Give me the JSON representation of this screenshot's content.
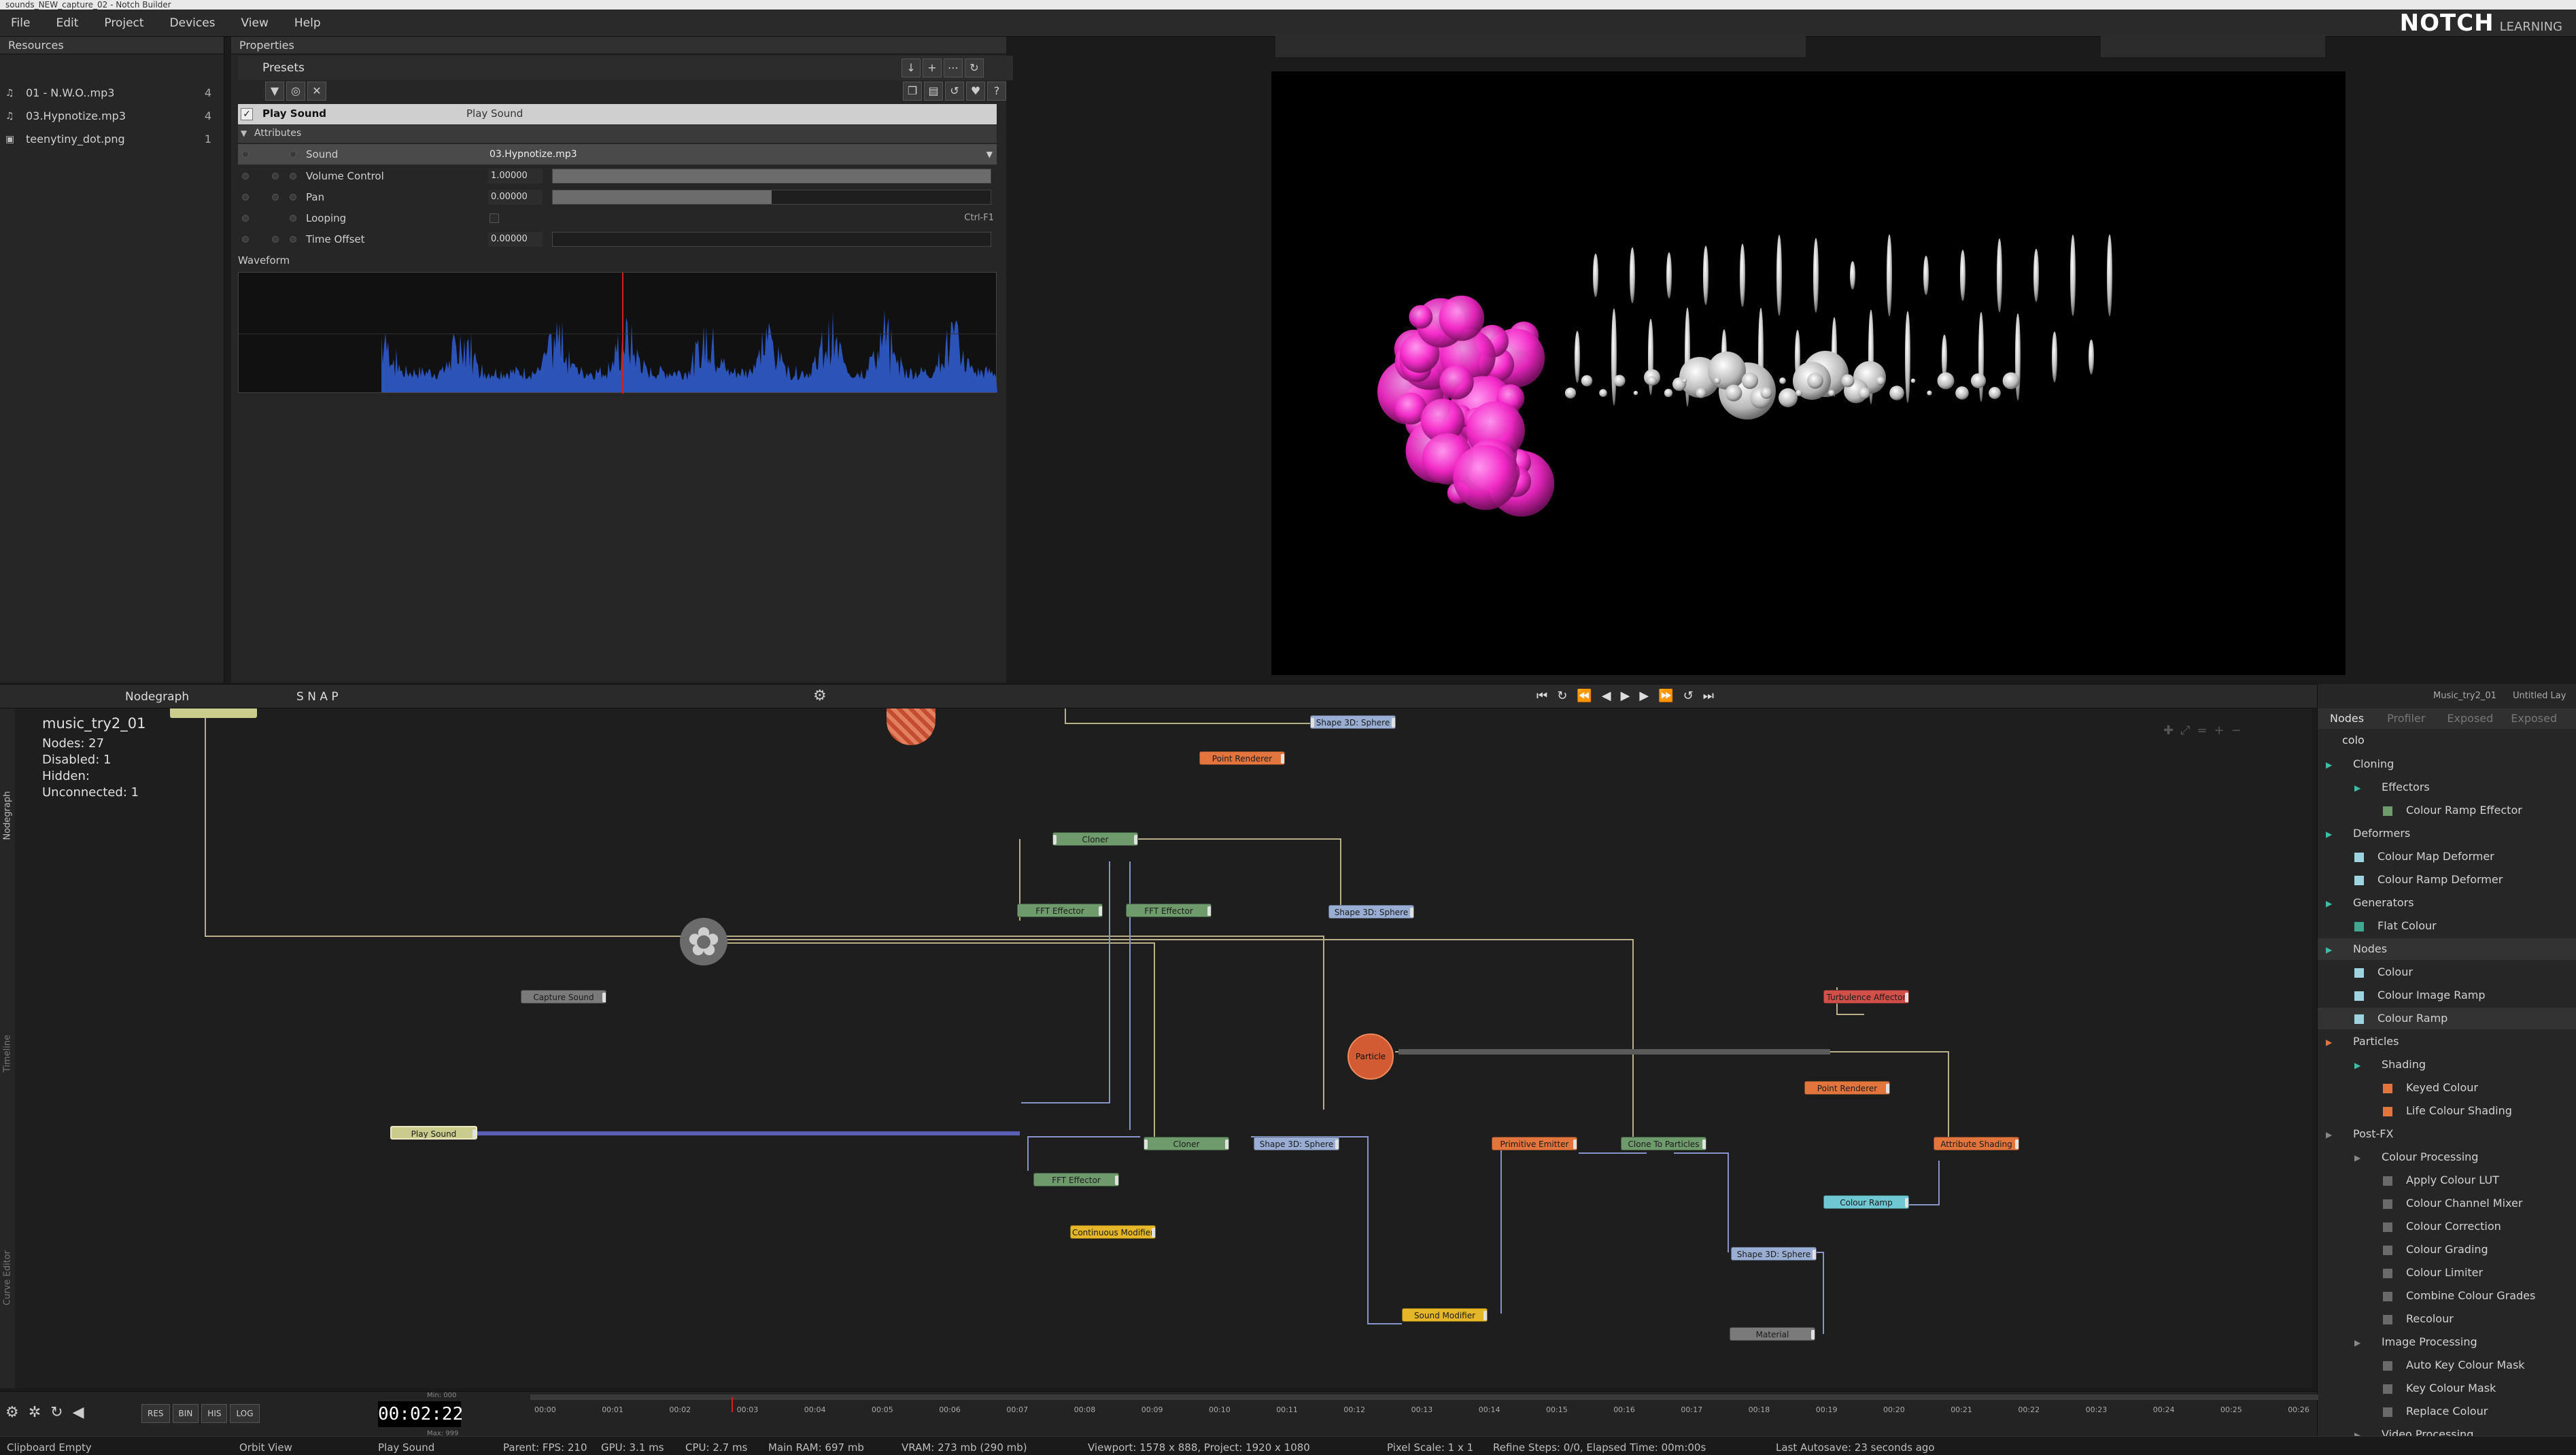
{
  "window": {
    "title": "sounds_NEW_capture_02 - Notch Builder"
  },
  "menu": [
    "File",
    "Edit",
    "Project",
    "Devices",
    "View",
    "Help"
  ],
  "logo": {
    "brand": "NOTCH",
    "sub": "LEARNING"
  },
  "resources": {
    "title": "Resources",
    "items": [
      {
        "name": "01 - N.W.O..mp3",
        "count": "4",
        "icon": "music-note-icon"
      },
      {
        "name": "03.Hypnotize.mp3",
        "count": "4",
        "icon": "music-note-icon"
      },
      {
        "name": "teenytiny_dot.png",
        "count": "1",
        "icon": "image-icon"
      }
    ]
  },
  "properties": {
    "title": "Properties",
    "presets": "Presets",
    "node_name": "Play Sound",
    "node_type": "Play Sound",
    "attributes_label": "Attributes",
    "rows": [
      {
        "label": "Sound",
        "value": "03.Hypnotize.mp3"
      },
      {
        "label": "Volume Control",
        "value": "1.00000",
        "fill": 1.0
      },
      {
        "label": "Pan",
        "value": "0.00000",
        "fill": 0.5
      },
      {
        "label": "Looping",
        "value": "",
        "shortcut": "Ctrl-F1"
      },
      {
        "label": "Time Offset",
        "value": "0.00000",
        "fill": 0
      }
    ],
    "waveform_label": "Waveform"
  },
  "nodegraph": {
    "tab": "Nodegraph",
    "project": "music_try2_01",
    "stats": [
      {
        "label": "Nodes:",
        "value": "27"
      },
      {
        "label": "Disabled:",
        "value": "1"
      },
      {
        "label": "Hidden:",
        "value": ""
      },
      {
        "label": "Unconnected:",
        "value": "1"
      }
    ],
    "toolbar_snap": "S N A P",
    "side_tabs": [
      "Nodegraph",
      "Timeline",
      "Curve Editor"
    ],
    "nodes": [
      {
        "label": "Shape 3D: Sphere",
        "color": "blue"
      },
      {
        "label": "Point Renderer",
        "color": "orange"
      },
      {
        "label": "Cloner",
        "color": "green"
      },
      {
        "label": "FFT Effector",
        "color": "green"
      },
      {
        "label": "FFT Effector",
        "color": "green"
      },
      {
        "label": "Shape 3D: Sphere",
        "color": "blue"
      },
      {
        "label": "Capture Sound",
        "color": "grey"
      },
      {
        "label": "Particle",
        "color": "orange"
      },
      {
        "label": "Turbulence Affector",
        "color": "red"
      },
      {
        "label": "Point Renderer",
        "color": "orange"
      },
      {
        "label": "Play Sound",
        "color": "lime"
      },
      {
        "label": "Cloner",
        "color": "green"
      },
      {
        "label": "Shape 3D: Sphere",
        "color": "blue"
      },
      {
        "label": "Primitive Emitter",
        "color": "orange"
      },
      {
        "label": "Clone To Particles",
        "color": "green"
      },
      {
        "label": "Attribute Shading",
        "color": "orange"
      },
      {
        "label": "FFT Effector",
        "color": "green"
      },
      {
        "label": "Continuous Modifier",
        "color": "yellow"
      },
      {
        "label": "Colour Ramp",
        "color": "cyan"
      },
      {
        "label": "Shape 3D: Sphere",
        "color": "blue"
      },
      {
        "label": "Sound Modifier",
        "color": "yellow"
      },
      {
        "label": "Material",
        "color": "grey"
      }
    ]
  },
  "nodes_panel": {
    "tabs": [
      "Nodes",
      "Profiler",
      "Exposed",
      "Exposed"
    ],
    "doc_tabs": [
      "Music_try2_01",
      "Untitled Lay"
    ],
    "search": "colo",
    "tree": [
      {
        "label": "Cloning",
        "level": 0,
        "type": "cat"
      },
      {
        "label": "Effectors",
        "level": 1,
        "type": "cat"
      },
      {
        "label": "Colour Ramp Effector",
        "level": 2,
        "type": "node",
        "color": "#6f9a6c"
      },
      {
        "label": "Deformers",
        "level": 0,
        "type": "cat"
      },
      {
        "label": "Colour Map Deformer",
        "level": 1,
        "type": "node",
        "color": "#9ed3e0"
      },
      {
        "label": "Colour Ramp Deformer",
        "level": 1,
        "type": "node",
        "color": "#9ed3e0"
      },
      {
        "label": "Generators",
        "level": 0,
        "type": "cat"
      },
      {
        "label": "Flat Colour",
        "level": 1,
        "type": "node",
        "color": "#3fa88f"
      },
      {
        "label": "Nodes",
        "level": 0,
        "type": "cat"
      },
      {
        "label": "Colour",
        "level": 1,
        "type": "node",
        "color": "#9ed3e0"
      },
      {
        "label": "Colour Image Ramp",
        "level": 1,
        "type": "node",
        "color": "#9ed3e0"
      },
      {
        "label": "Colour Ramp",
        "level": 1,
        "type": "node",
        "color": "#9ed3e0"
      },
      {
        "label": "Particles",
        "level": 0,
        "type": "cat"
      },
      {
        "label": "Shading",
        "level": 1,
        "type": "cat"
      },
      {
        "label": "Keyed Colour",
        "level": 2,
        "type": "node",
        "color": "#e1753d"
      },
      {
        "label": "Life Colour Shading",
        "level": 2,
        "type": "node",
        "color": "#e1753d"
      },
      {
        "label": "Post-FX",
        "level": 0,
        "type": "cat"
      },
      {
        "label": "Colour Processing",
        "level": 1,
        "type": "cat"
      },
      {
        "label": "Apply Colour LUT",
        "level": 2,
        "type": "node",
        "color": "#6a6a6a"
      },
      {
        "label": "Colour Channel Mixer",
        "level": 2,
        "type": "node",
        "color": "#6a6a6a"
      },
      {
        "label": "Colour Correction",
        "level": 2,
        "type": "node",
        "color": "#6a6a6a"
      },
      {
        "label": "Colour Grading",
        "level": 2,
        "type": "node",
        "color": "#6a6a6a"
      },
      {
        "label": "Colour Limiter",
        "level": 2,
        "type": "node",
        "color": "#6a6a6a"
      },
      {
        "label": "Combine Colour Grades",
        "level": 2,
        "type": "node",
        "color": "#6a6a6a"
      },
      {
        "label": "Recolour",
        "level": 2,
        "type": "node",
        "color": "#6a6a6a"
      },
      {
        "label": "Image Processing",
        "level": 1,
        "type": "cat"
      },
      {
        "label": "Auto Key Colour Mask",
        "level": 2,
        "type": "node",
        "color": "#6a6a6a"
      },
      {
        "label": "Key Colour Mask",
        "level": 2,
        "type": "node",
        "color": "#6a6a6a"
      },
      {
        "label": "Replace Colour",
        "level": 2,
        "type": "node",
        "color": "#6a6a6a"
      },
      {
        "label": "Video Processing",
        "level": 1,
        "type": "cat"
      }
    ]
  },
  "transport": {
    "buttons": [
      "RES",
      "BIN",
      "HIS",
      "LOG"
    ],
    "time": "00:02:22",
    "min": "Min: 000",
    "max": "Max: 999",
    "ticks": [
      "00:00",
      "00:01",
      "00:02",
      "00:03",
      "00:04",
      "00:05",
      "00:06",
      "00:07",
      "00:08",
      "00:09",
      "00:10",
      "00:11",
      "00:12",
      "00:13",
      "00:14",
      "00:15",
      "00:16",
      "00:17",
      "00:18",
      "00:19",
      "00:20",
      "00:21",
      "00:22",
      "00:23",
      "00:24",
      "00:25",
      "00:26"
    ]
  },
  "statusbar": {
    "clipboard": "Clipboard Empty",
    "view": "Orbit View",
    "node": "Play Sound",
    "parent": "Parent: FPS: 210",
    "gpu": "GPU: 3.1 ms",
    "cpu": "CPU: 2.7 ms",
    "ram": "Main RAM: 697 mb",
    "vram": "VRAM: 273 mb (290 mb)",
    "viewport": "Viewport: 1578 x 888, Project: 1920 x 1080",
    "pixel": "Pixel Scale: 1 x 1",
    "refine": "Refine Steps: 0/0, Elapsed Time: 00m:00s",
    "autosave": "Last Autosave: 23 seconds ago"
  },
  "colors": {
    "accent": "#3bbfa7",
    "waveform": "#2b53b8",
    "playhead": "#d02020",
    "magenta": "#ff3ad7"
  }
}
